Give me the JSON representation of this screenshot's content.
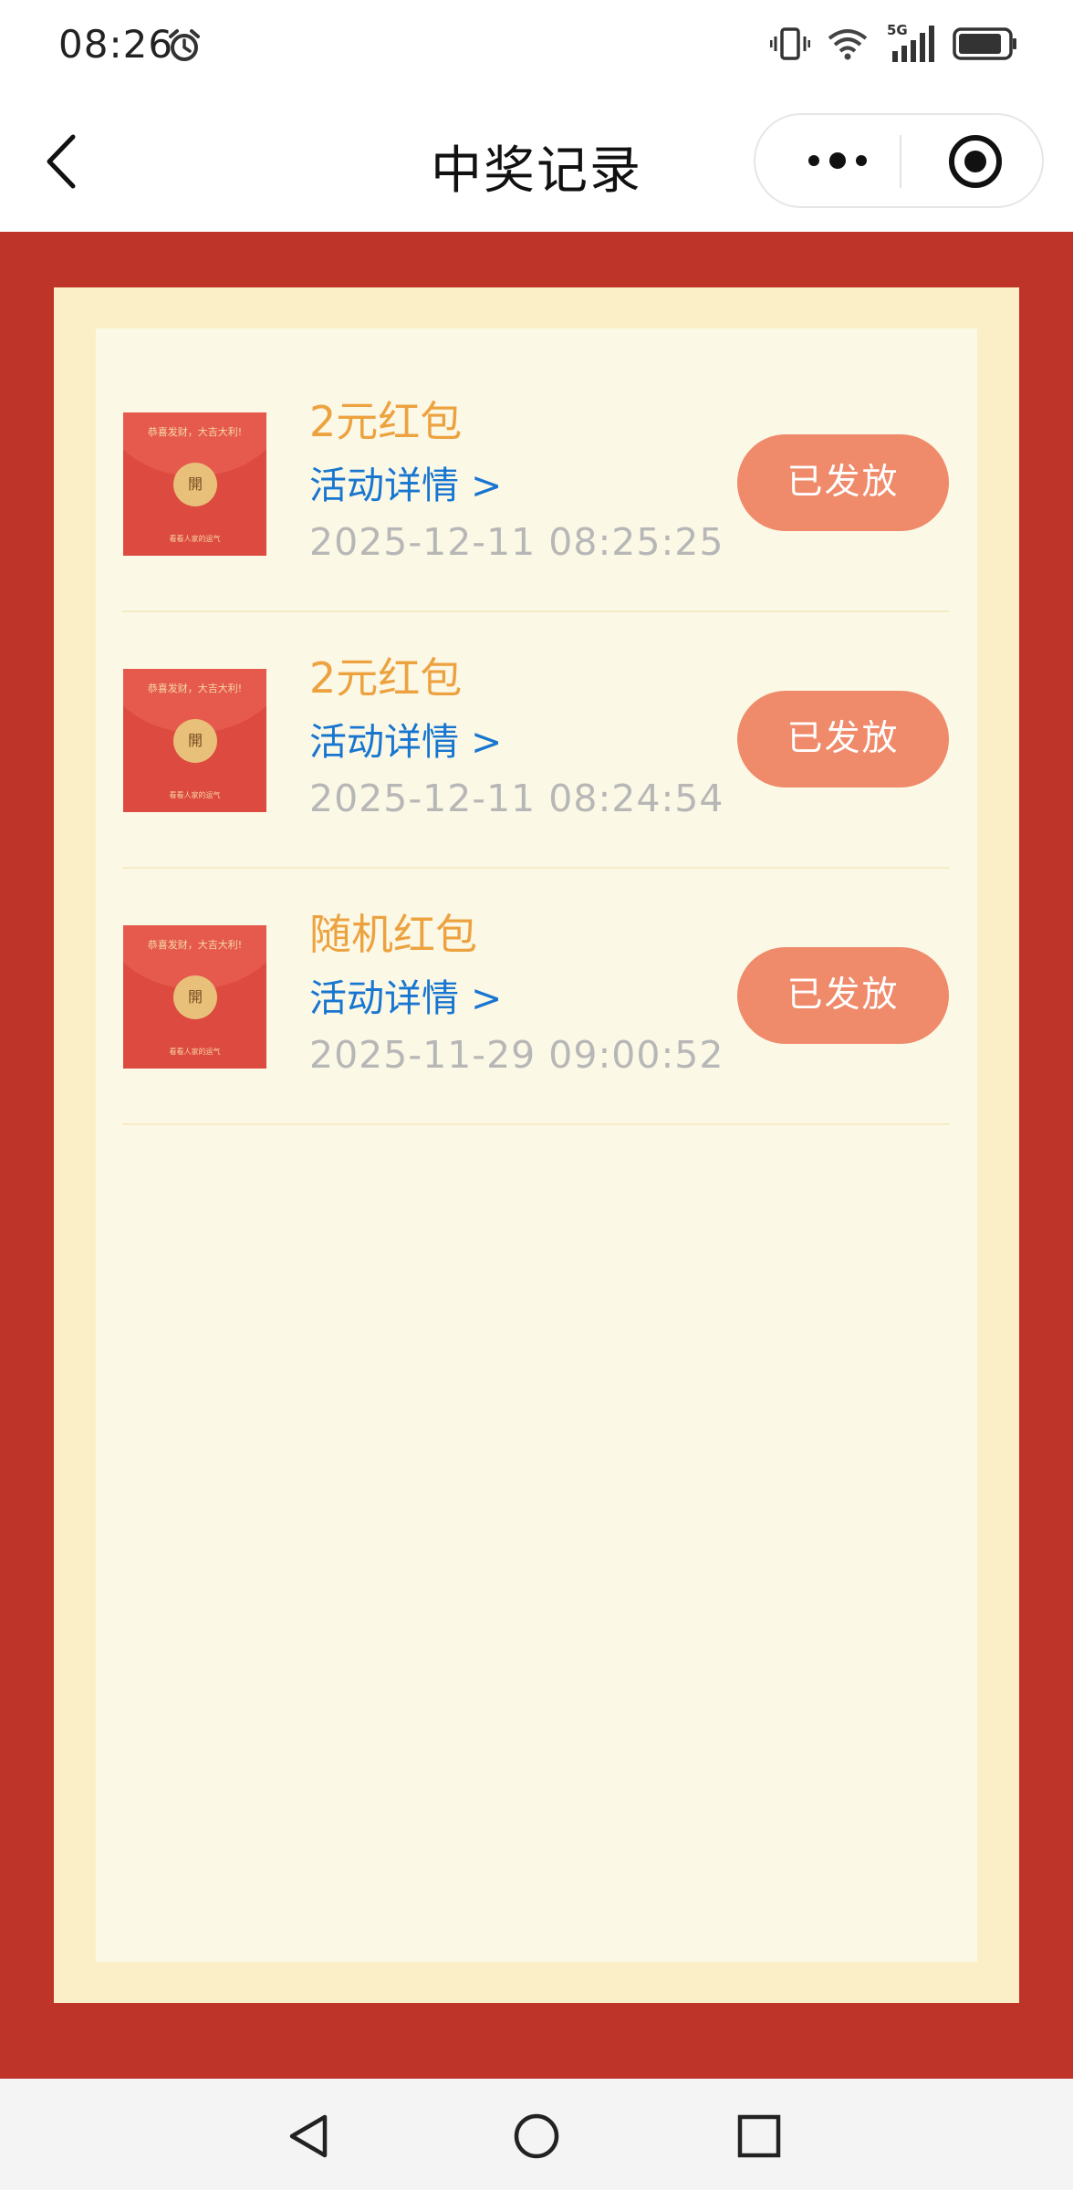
{
  "status_bar": {
    "time": "08:26",
    "icons": [
      "alarm-icon",
      "vibrate-icon",
      "wifi-icon",
      "signal-5g-icon",
      "battery-icon"
    ],
    "network_label": "5G"
  },
  "nav": {
    "title": "中奖记录",
    "icons": [
      "back-icon",
      "more-icon",
      "target-icon"
    ]
  },
  "records": [
    {
      "title": "2元红包",
      "link_text": "活动详情 >",
      "time": "2025-12-11 08:25:25",
      "status": "已发放",
      "thumb": {
        "top_text": "恭喜发财，大吉大利!",
        "coin_text": "開",
        "bottom_text": "看看人家的运气"
      }
    },
    {
      "title": "2元红包",
      "link_text": "活动详情 >",
      "time": "2025-12-11 08:24:54",
      "status": "已发放",
      "thumb": {
        "top_text": "恭喜发财，大吉大利!",
        "coin_text": "開",
        "bottom_text": "看看人家的运气"
      }
    },
    {
      "title": "随机红包",
      "link_text": "活动详情 >",
      "time": "2025-11-29 09:00:52",
      "status": "已发放",
      "thumb": {
        "top_text": "恭喜发财，大吉大利!",
        "coin_text": "開",
        "bottom_text": "看看人家的运气"
      }
    }
  ],
  "system_nav": {
    "icons": [
      "back-triangle-icon",
      "home-circle-icon",
      "recents-square-icon"
    ]
  },
  "colors": {
    "background_red": "#bf3428",
    "frame_yellow": "#fbefc7",
    "panel": "#fcf8e6",
    "title_orange": "#eda240",
    "link_blue": "#1876d0",
    "time_gray": "#b7b7b7",
    "button": "#ef8a6a"
  }
}
